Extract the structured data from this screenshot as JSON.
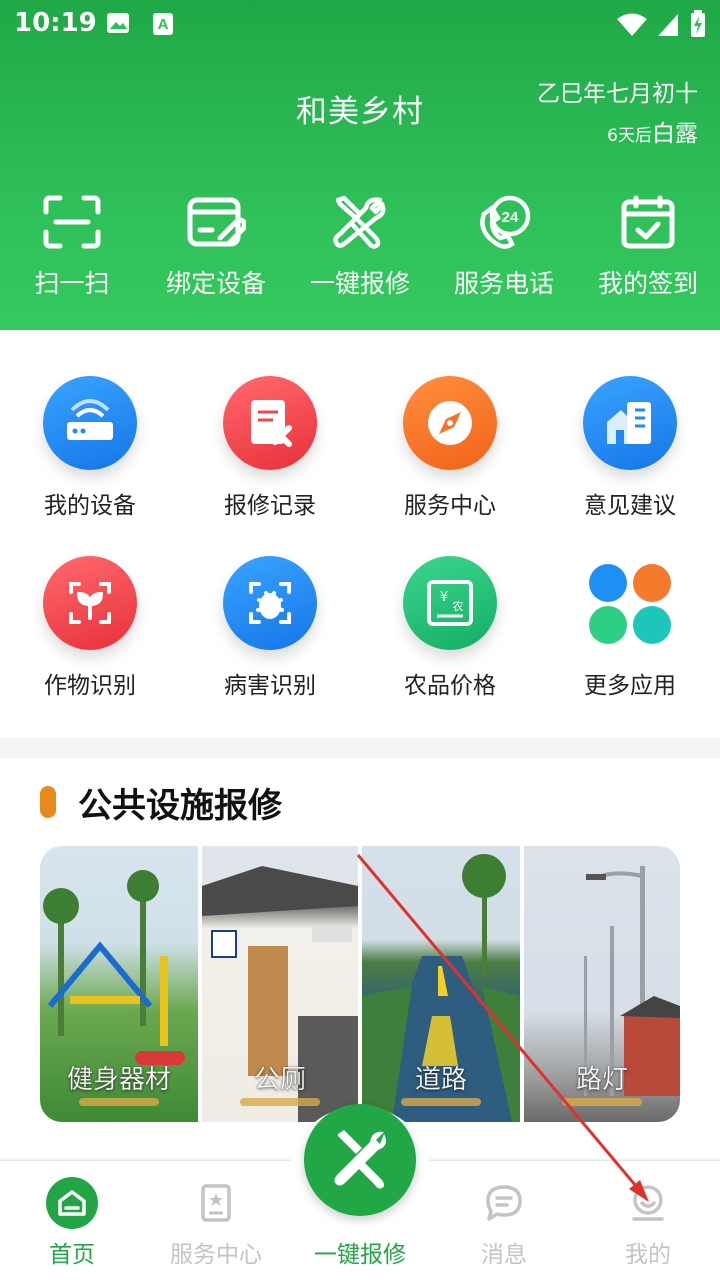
{
  "status_bar": {
    "time": "10:19"
  },
  "header": {
    "title": "和美乡村",
    "lunar_date": "乙巳年七月初十",
    "solar_term_prefix": "6天后",
    "solar_term": "白露"
  },
  "quick_actions": [
    {
      "label": "扫一扫",
      "icon": "scan-icon"
    },
    {
      "label": "绑定设备",
      "icon": "bind-device-icon"
    },
    {
      "label": "一键报修",
      "icon": "repair-tools-icon"
    },
    {
      "label": "服务电话",
      "icon": "phone-24h-icon"
    },
    {
      "label": "我的签到",
      "icon": "calendar-check-icon"
    }
  ],
  "apps": [
    {
      "label": "我的设备",
      "icon": "router-icon",
      "color": "#1e8bf2"
    },
    {
      "label": "报修记录",
      "icon": "repair-record-icon",
      "color": "#f2434a"
    },
    {
      "label": "服务中心",
      "icon": "compass-icon",
      "color": "#f97323"
    },
    {
      "label": "意见建议",
      "icon": "building-icon",
      "color": "#1e8bf2"
    },
    {
      "label": "作物识别",
      "icon": "plant-scan-icon",
      "color": "#f2434a"
    },
    {
      "label": "病害识别",
      "icon": "bug-scan-icon",
      "color": "#1e8bf2"
    },
    {
      "label": "农品价格",
      "icon": "price-board-icon",
      "color": "#23c278"
    },
    {
      "label": "更多应用",
      "icon": "more-apps-icon",
      "color": "#1e8bf2"
    }
  ],
  "section": {
    "title": "公共设施报修",
    "items": [
      {
        "label": "健身器材"
      },
      {
        "label": "公厕"
      },
      {
        "label": "道路"
      },
      {
        "label": "路灯"
      }
    ]
  },
  "tabbar": [
    {
      "label": "首页",
      "active": true
    },
    {
      "label": "服务中心",
      "active": false
    },
    {
      "label": "一键报修",
      "active": true
    },
    {
      "label": "消息",
      "active": false
    },
    {
      "label": "我的",
      "active": false
    }
  ],
  "colors": {
    "brand": "#21a745",
    "accent_bar": "#e8891b"
  }
}
